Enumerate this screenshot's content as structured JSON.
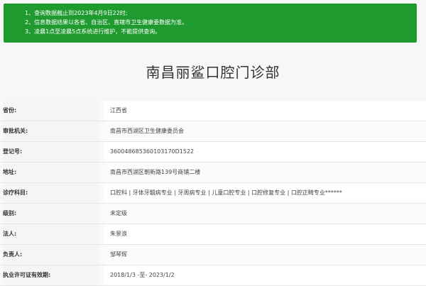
{
  "notice": {
    "lines": [
      "1、查询数据截止到2023年4月9日22时;",
      "2、信息数据结果以各省、自治区、直辖市卫生健康委数据为准。",
      "3、凌晨1点至凌晨5点系统进行维护，不能提供查询。"
    ]
  },
  "page_title": "南昌丽鲨口腔门诊部",
  "rows": [
    {
      "label": "省份:",
      "value": "江西省"
    },
    {
      "label": "审批机关:",
      "value": "南昌市西湖区卫生健康委员会"
    },
    {
      "label": "登记号:",
      "value": "360048685360103170D1522"
    },
    {
      "label": "地址:",
      "value": "南昌市西湖区朝新路139号商铺二楼"
    },
    {
      "label": "诊疗科目:",
      "value": "口腔科 | 牙体牙髓病专业 | 牙周病专业 | 儿童口腔专业 | 口腔修复专业 | 口腔正畸专业******"
    },
    {
      "label": "级别:",
      "value": "未定级"
    },
    {
      "label": "法人:",
      "value": "朱景浪"
    },
    {
      "label": "负责人:",
      "value": "邹琴辉"
    },
    {
      "label": "执业许可证有效期:",
      "value": "2018/1/3 -至- 2023/1/2"
    }
  ]
}
